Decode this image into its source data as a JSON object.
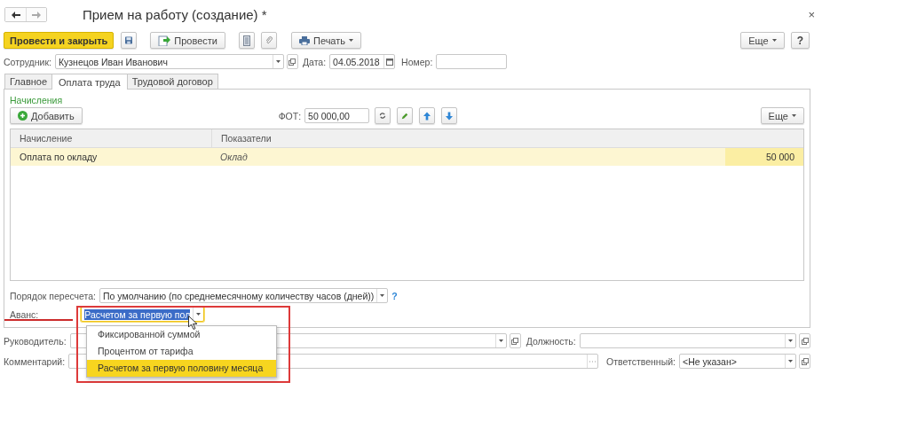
{
  "window": {
    "title": "Прием на работу (создание) *",
    "close": "×"
  },
  "toolbar": {
    "post_and_close": "Провести и закрыть",
    "post": "Провести",
    "print": "Печать",
    "more": "Еще",
    "help": "?"
  },
  "header": {
    "employee_label": "Сотрудник:",
    "employee": "Кузнецов Иван Иванович",
    "date_label": "Дата:",
    "date": "04.05.2018",
    "number_label": "Номер:"
  },
  "tabs": [
    {
      "label": "Главное",
      "selected": false
    },
    {
      "label": "Оплата труда",
      "selected": true
    },
    {
      "label": "Трудовой договор",
      "selected": false
    }
  ],
  "accruals": {
    "title": "Начисления",
    "add": "Добавить",
    "fot_label": "ФОТ:",
    "fot": "50 000,00",
    "more": "Еще",
    "table": {
      "columns": [
        "Начисление",
        "Показатели"
      ],
      "rows": [
        {
          "accrual": "Оплата по окладу",
          "indicator": "Оклад",
          "amount": "50 000",
          "selected": true
        }
      ]
    }
  },
  "recalc": {
    "label": "Порядок пересчета:",
    "value": "По умолчанию (по среднемесячному количеству часов (дней))",
    "help": "?"
  },
  "advance": {
    "label": "Аванс:",
    "value": "Расчетом за первую пол",
    "expanded": true,
    "options": [
      {
        "label": "Фиксированной суммой",
        "selected": false
      },
      {
        "label": "Процентом от тарифа",
        "selected": false
      },
      {
        "label": "Расчетом за первую половину месяца",
        "selected": true
      }
    ]
  },
  "footer": {
    "manager_label": "Руководитель:",
    "position_label": "Должность:",
    "comment_label": "Комментарий:",
    "responsible_label": "Ответственный:",
    "responsible": "<Не указан>"
  }
}
